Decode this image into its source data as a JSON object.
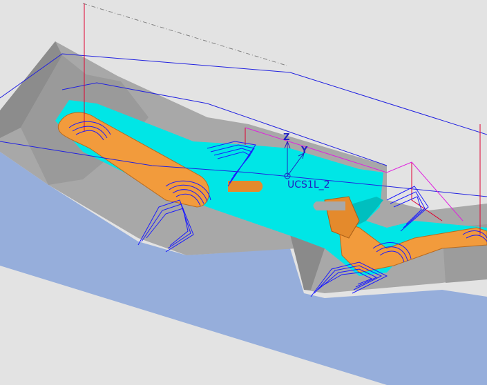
{
  "viewport": {
    "background": "#e3e3e3",
    "ucs_name": "UCS1L_2",
    "axis_z_label": "Z",
    "axis_y_label": "Y"
  },
  "colors": {
    "workpiece_top": "#a6a6a6",
    "workpiece_side": "#8f8f8f",
    "workpiece_front": "#96aedb",
    "pocket_floor": "#00e6e6",
    "part_surface": "#f29b3c",
    "toolpath": "#1a1aff",
    "boundary_line": "#2020e0",
    "feed_lines": "#e00050",
    "ucs_color": "#2020c0"
  },
  "icons": {
    "ucs": "ucs-axis-icon"
  }
}
